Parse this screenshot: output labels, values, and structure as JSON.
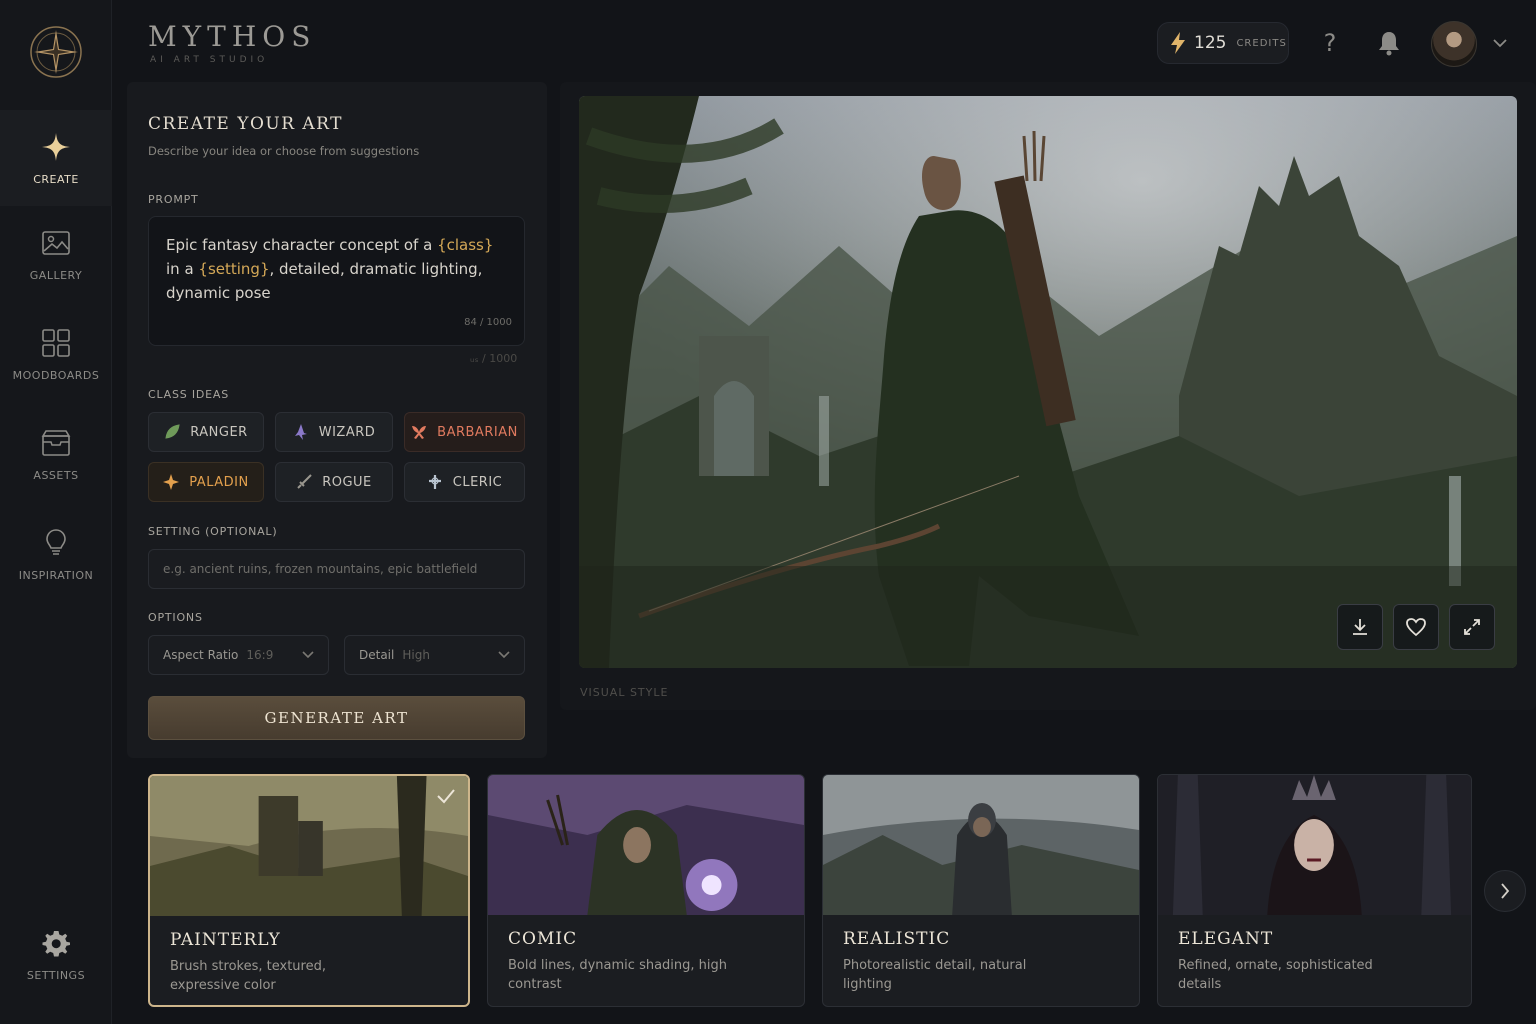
{
  "brand": {
    "name": "MYTHOS",
    "tagline": "AI ART STUDIO"
  },
  "header": {
    "credits_value": "125",
    "credits_label": "CREDITS",
    "help": "?"
  },
  "sidebar": {
    "items": [
      {
        "label": "CREATE",
        "icon": "sparkle-icon",
        "active": true
      },
      {
        "label": "GALLERY",
        "icon": "image-icon"
      },
      {
        "label": "MOODBOARDS",
        "icon": "grid-icon"
      },
      {
        "label": "ASSETS",
        "icon": "box-icon"
      },
      {
        "label": "INSPIRATION",
        "icon": "lightbulb-icon"
      }
    ],
    "settings_label": "SETTINGS"
  },
  "panel": {
    "title": "CREATE YOUR ART",
    "subtitle": "Describe your idea or choose from suggestions",
    "prompt_label": "PROMPT",
    "prompt_parts": {
      "p1": "Epic fantasy character concept of a ",
      "class_tag": "{class}",
      "p2": " in a ",
      "setting_tag": "{setting}",
      "p3": ", detailed, dramatic lighting, dynamic pose"
    },
    "prompt_counter": "84 / 1000",
    "ghost_counter": "ᵤₛ / 1000",
    "class_label": "CLASS IDEAS",
    "classes": [
      "RANGER",
      "WIZARD",
      "BARBARIAN",
      "PALADIN",
      "ROGUE",
      "CLERIC"
    ],
    "setting_label": "SETTING (OPTIONAL)",
    "setting_placeholder": "e.g. ancient ruins, frozen mountains, epic battlefield",
    "options_label": "OPTIONS",
    "aspect_label": "Aspect Ratio",
    "aspect_value": "16:9",
    "detail_label": "Detail",
    "detail_value": "High",
    "generate_label": "GENERATE ART"
  },
  "preview": {
    "visual_style_label": "VISUAL STYLE"
  },
  "styles": [
    {
      "title": "PAINTERLY",
      "desc": "Brush strokes, textured, expressive color",
      "selected": true
    },
    {
      "title": "COMIC",
      "desc": "Bold lines, dynamic shading, high contrast"
    },
    {
      "title": "REALISTIC",
      "desc": "Photorealistic detail, natural lighting"
    },
    {
      "title": "ELEGANT",
      "desc": "Refined, ornate, sophisticated details"
    }
  ],
  "colors": {
    "accent_gold": "#d4a857",
    "barbarian": "#e07a5f",
    "paladin": "#e3a04d",
    "selected_border": "#cdb58b"
  }
}
